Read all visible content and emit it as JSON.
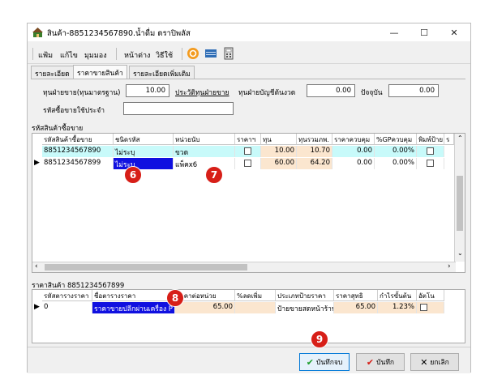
{
  "window": {
    "title": "สินค้า-8851234567890.น้ำดื่ม ตราปิพลัส",
    "controls": {
      "minimize": "—",
      "maximize": "☐",
      "close": "✕"
    }
  },
  "menu": {
    "items": [
      "แฟ้ม",
      "แก้ไข",
      "มุมมอง",
      "หน้าต่าง",
      "วิธีใช้"
    ],
    "toolbar_icons": [
      "refresh-icon",
      "table-icon",
      "calculator-icon"
    ]
  },
  "tabs": [
    "รายละเอียด",
    "ราคาขายสินค้า",
    "รายละเอียดเพิ่มเติม"
  ],
  "cost": {
    "standard_label": "ทุนฝ่ายขาย(ทุนมาตรฐาน)",
    "standard_value": "10.00",
    "history_link": "ประวัติทุนฝ่ายขาย",
    "accounting_label": "ทุนฝ่ายบัญชีต้นงวด",
    "accounting_value": "0.00",
    "current_label": "ปัจจุบัน",
    "current_value": "0.00",
    "default_code_label": "รหัสซื้อขายใช้ประจำ",
    "default_code_value": ""
  },
  "codes_group": {
    "title": "รหัสสินค้าซื้อขาย",
    "headers": [
      "รหัสสินค้าซื้อขาย",
      "ชนิดรหัส",
      "หน่วยนับ",
      "ราคาฯ",
      "ทุน",
      "ทุนรวมภพ.",
      "ราคาควบคุม",
      "%GPควบคุม",
      "พิมพ์ป้าย",
      "ร"
    ],
    "rows": [
      {
        "code": "8851234567890",
        "type": "ไม่ระบุ",
        "unit": "ขวด",
        "cost": "10.00",
        "cost_vat": "10.70",
        "control_price": "0.00",
        "gp": "0.00%"
      },
      {
        "code": "8851234567899",
        "type": "ไม่ระบุ",
        "unit": "แพ็คx6",
        "cost": "60.00",
        "cost_vat": "64.20",
        "control_price": "0.00",
        "gp": "0.00%"
      }
    ]
  },
  "price_group": {
    "title": "ราคาสินค้า 8851234567899",
    "headers": [
      "รหัสตารางราคา",
      "ชื่อตารางราคา",
      "ราคาต่อหน่วย",
      "%ลดเพิ่ม",
      "ประเภทป้ายราคา",
      "ราคาสุทธิ",
      "กำไรขั้นต้น",
      "อัตโน"
    ],
    "rows": [
      {
        "code": "0",
        "name": "ราคาขายปลีกผ่านเครื่อง P",
        "unit_price": "65.00",
        "discount": "",
        "label_type": "ป้ายขายสดหน้าร้าน",
        "net": "65.00",
        "profit": "1.23%"
      }
    ]
  },
  "badges": [
    "6",
    "7",
    "8",
    "9"
  ],
  "buttons": {
    "save_close": "บันทึกจบ",
    "save": "บันทึก",
    "cancel": "ยกเลิก"
  },
  "colors": {
    "selection": "#1010e0",
    "cyan_row": "#c8fafa",
    "peach_cell": "#fbe6cf",
    "badge": "#d71f18"
  }
}
